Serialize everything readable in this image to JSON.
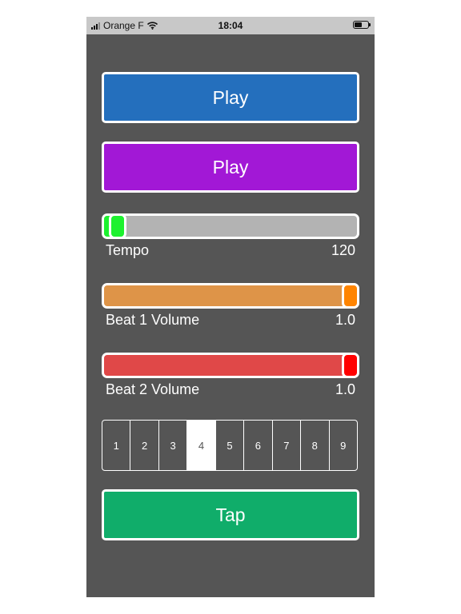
{
  "status_bar": {
    "carrier": "Orange F",
    "time": "18:04"
  },
  "play_button_1": {
    "label": "Play",
    "color": "#246fbd"
  },
  "play_button_2": {
    "label": "Play",
    "color": "#a218d6"
  },
  "tempo_slider": {
    "label": "Tempo",
    "value": "120",
    "track_color": "#b3b3b3",
    "thumb_color": "#1df12f",
    "level": 0.0
  },
  "beat1_volume_slider": {
    "label": "Beat 1 Volume",
    "value": "1.0",
    "track_color": "#de9448",
    "thumb_color": "#ff8400",
    "level": 1.0
  },
  "beat2_volume_slider": {
    "label": "Beat 2 Volume",
    "value": "1.0",
    "track_color": "#e04848",
    "thumb_color": "#ff0000",
    "level": 1.0
  },
  "beat_selector": {
    "options": [
      "1",
      "2",
      "3",
      "4",
      "5",
      "6",
      "7",
      "8",
      "9"
    ],
    "selected": "4"
  },
  "tap_button": {
    "label": "Tap",
    "color": "#10ad6a"
  },
  "colors": {
    "background": "#555555",
    "status_bar": "#c8c8c8",
    "border": "#ffffff"
  }
}
